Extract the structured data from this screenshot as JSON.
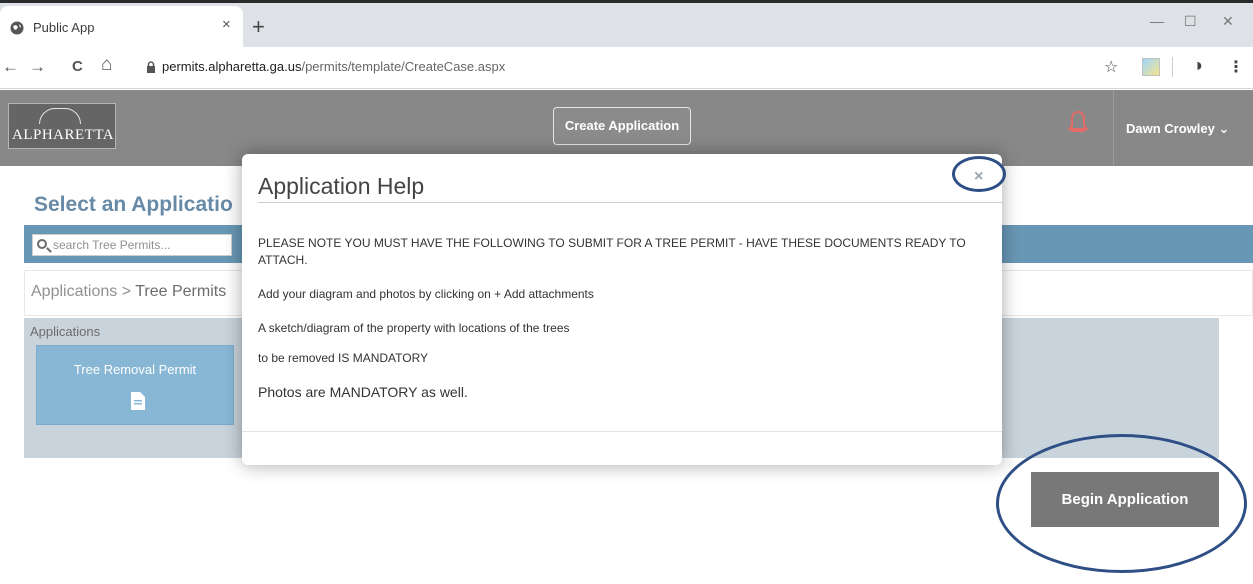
{
  "browser": {
    "tab_title": "Public App",
    "tab_close": "×",
    "new_tab": "+",
    "win_min": "—",
    "win_max": "☐",
    "win_close": "✕",
    "back": "←",
    "forward": "→",
    "reload": "C",
    "home": "⌂",
    "url_host": "permits.alpharetta.ga.us",
    "url_path": "/permits/template/CreateCase.aspx",
    "star": "☆",
    "account": "◑",
    "menu": "⋮"
  },
  "header": {
    "logo_text": "ALPHARETTA",
    "create_application": "Create Application",
    "user_name": "Dawn Crowley ⌄"
  },
  "main": {
    "title": "Select an Applicatio",
    "search_placeholder": "search Tree Permits...",
    "breadcrumb_root": "Applications",
    "breadcrumb_sep": " > ",
    "breadcrumb_current": "Tree Permits",
    "apps_label": "Applications",
    "app_tile_label": "Tree Removal Permit",
    "begin_button": "Begin Application"
  },
  "modal": {
    "title": "Application Help",
    "close": "×",
    "line1": "PLEASE NOTE YOU MUST HAVE THE FOLLOWING TO SUBMIT FOR A TREE PERMIT - HAVE THESE DOCUMENTS READY TO ATTACH.",
    "line2": "Add your diagram and photos by clicking on + Add attachments",
    "line3": "A sketch/diagram of the property with locations of the trees",
    "line4": "to be removed IS MANDATORY",
    "line5": "Photos are MANDATORY as well."
  },
  "colors": {
    "accent_blue": "#2f6f99",
    "title_blue": "#2d5e86",
    "bell_red": "#d9322f",
    "annotation": "#2e4e86"
  }
}
